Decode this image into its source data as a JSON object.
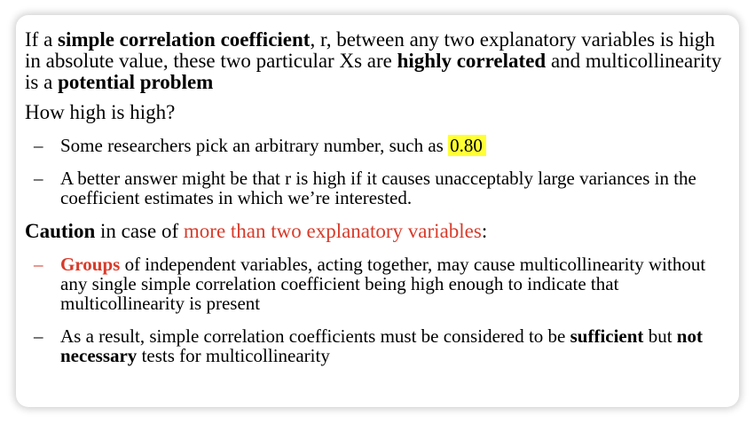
{
  "slide": {
    "p1": {
      "t1": "If a ",
      "b1": "simple correlation coefficient",
      "t2": ", r, between any two explanatory variables is high in absolute value, these two particular Xs are ",
      "b2": "highly correlated",
      "t3": " and multicollinearity is a ",
      "b3": "potential problem"
    },
    "p2": "How high is high?",
    "bullet1": {
      "dash": "–",
      "text": "Some researchers pick an arbitrary number, such as ",
      "highlight": "0.80"
    },
    "bullet2": {
      "dash": "–",
      "text": "A better answer might be that r is high if it causes unacceptably large variances in the coefficient estimates in which we’re interested."
    },
    "p3": {
      "b1": "Caution",
      "t1": " in case of ",
      "red": "more than two explanatory variables",
      "t2": ":"
    },
    "bullet3": {
      "dash": "–",
      "red_bold": "Groups",
      "text": " of independent variables, acting together, may cause multicollinearity without any single simple correlation coefficient being high enough to indicate that multicollinearity is present"
    },
    "bullet4": {
      "dash": "–",
      "t1": "As a result, simple correlation coefficients must be considered to be ",
      "b1": "sufficient",
      "t2": " but ",
      "b2": "not necessary",
      "t3": " tests for multicollinearity"
    }
  },
  "colors": {
    "accent_red": "#d83b2a",
    "highlight": "#ffff33"
  }
}
